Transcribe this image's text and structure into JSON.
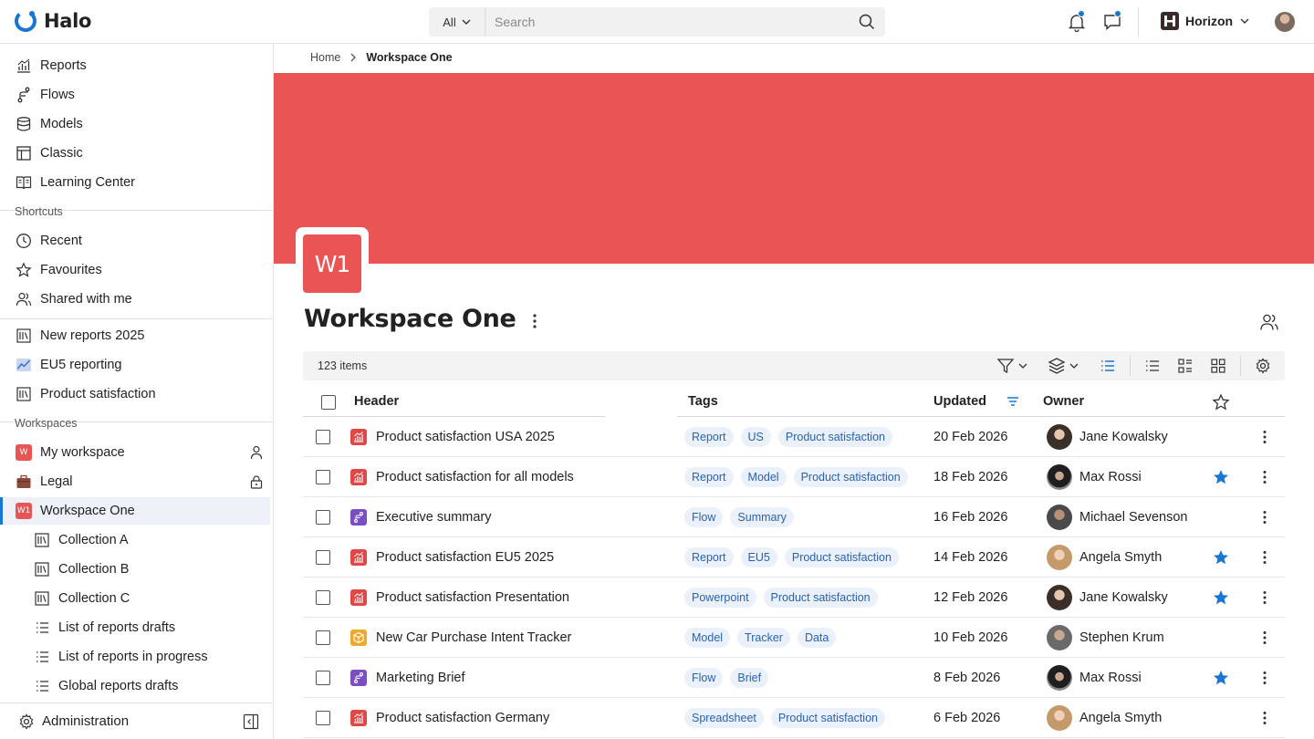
{
  "app": {
    "name": "Halo"
  },
  "search": {
    "scope": "All",
    "placeholder": "Search"
  },
  "org": {
    "name": "Horizon"
  },
  "sidebar": {
    "main_items": [
      {
        "label": "Reports",
        "icon": "bar-chart-icon"
      },
      {
        "label": "Flows",
        "icon": "flow-icon"
      },
      {
        "label": "Models",
        "icon": "database-icon"
      },
      {
        "label": "Classic",
        "icon": "table-icon"
      },
      {
        "label": "Learning Center",
        "icon": "book-icon"
      }
    ],
    "shortcuts_label": "Shortcuts",
    "shortcuts": [
      {
        "label": "Recent",
        "icon": "clock-icon"
      },
      {
        "label": "Favourites",
        "icon": "star-icon"
      },
      {
        "label": "Shared with me",
        "icon": "people-icon"
      }
    ],
    "pinned": [
      {
        "label": "New reports 2025",
        "icon": "collection-icon"
      },
      {
        "label": "EU5 reporting",
        "icon": "line-chart-icon"
      },
      {
        "label": "Product satisfaction",
        "icon": "collection-icon"
      }
    ],
    "workspaces_label": "Workspaces",
    "workspaces": [
      {
        "label": "My workspace",
        "badge": "W",
        "trail": "person-icon"
      },
      {
        "label": "Legal",
        "trail": "lock-icon"
      },
      {
        "label": "Workspace One",
        "badge": "W1",
        "active": true
      }
    ],
    "sub_items": [
      {
        "label": "Collection A",
        "icon": "collection-icon"
      },
      {
        "label": "Collection B",
        "icon": "collection-icon"
      },
      {
        "label": "Collection C",
        "icon": "collection-icon"
      },
      {
        "label": "List of reports drafts",
        "icon": "list-icon"
      },
      {
        "label": "List of reports in progress",
        "icon": "list-icon"
      },
      {
        "label": "Global reports drafts",
        "icon": "list-icon"
      }
    ],
    "admin_label": "Administration"
  },
  "breadcrumb": {
    "home": "Home",
    "current": "Workspace One"
  },
  "workspace": {
    "badge": "W1",
    "title": "Workspace One",
    "banner_color": "#eb5454"
  },
  "toolbar": {
    "count": "123 items"
  },
  "table": {
    "headers": {
      "header": "Header",
      "tags": "Tags",
      "updated": "Updated",
      "owner": "Owner"
    },
    "rows": [
      {
        "type": "report",
        "title": "Product satisfaction USA 2025",
        "tags": [
          "Report",
          "US",
          "Product satisfaction"
        ],
        "updated": "20 Feb 2026",
        "owner": "Jane Kowalsky",
        "avatar": "av1",
        "starred": false
      },
      {
        "type": "report",
        "title": "Product satisfaction for all models",
        "tags": [
          "Report",
          "Model",
          "Product satisfaction"
        ],
        "updated": "18 Feb 2026",
        "owner": "Max Rossi",
        "avatar": "av2",
        "starred": true
      },
      {
        "type": "flow",
        "title": "Executive summary",
        "tags": [
          "Flow",
          "Summary"
        ],
        "updated": "16 Feb 2026",
        "owner": "Michael Sevenson",
        "avatar": "av3",
        "starred": false
      },
      {
        "type": "report",
        "title": "Product satisfaction EU5 2025",
        "tags": [
          "Report",
          "EU5",
          "Product satisfaction"
        ],
        "updated": "14 Feb 2026",
        "owner": "Angela Smyth",
        "avatar": "av4",
        "starred": true
      },
      {
        "type": "report",
        "title": "Product satisfaction Presentation",
        "tags": [
          "Powerpoint",
          "Product satisfaction"
        ],
        "updated": "12 Feb 2026",
        "owner": "Jane Kowalsky",
        "avatar": "av1",
        "starred": true
      },
      {
        "type": "model",
        "title": "New Car Purchase Intent Tracker",
        "tags": [
          "Model",
          "Tracker",
          "Data"
        ],
        "updated": "10 Feb 2026",
        "owner": "Stephen Krum",
        "avatar": "av5",
        "starred": false
      },
      {
        "type": "flow",
        "title": "Marketing Brief",
        "tags": [
          "Flow",
          "Brief"
        ],
        "updated": "8 Feb 2026",
        "owner": "Max Rossi",
        "avatar": "av2",
        "starred": true
      },
      {
        "type": "report",
        "title": "Product satisfaction Germany",
        "tags": [
          "Spreadsheet",
          "Product satisfaction"
        ],
        "updated": "6 Feb 2026",
        "owner": "Angela Smyth",
        "avatar": "av4",
        "starred": false
      }
    ]
  }
}
